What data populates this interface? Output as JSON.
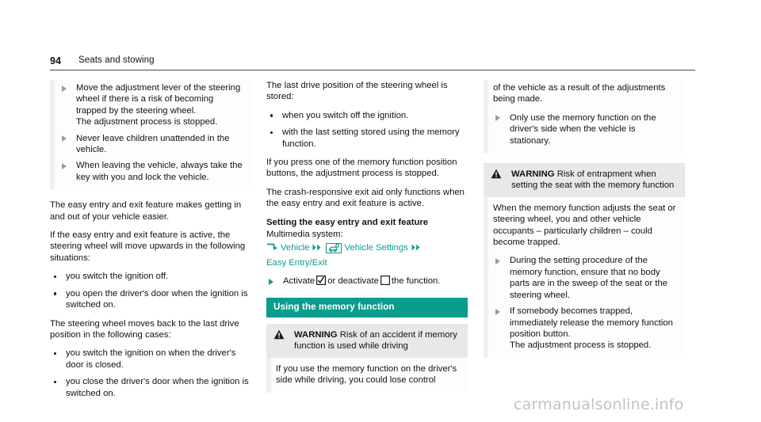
{
  "header": {
    "page_number": "94",
    "section_title": "Seats and stowing"
  },
  "colors": {
    "teal": "#0a9d8d",
    "warning_header_bg": "#e8e8e8",
    "watermark": "#c2c2c2"
  },
  "column1": {
    "continuation_box": {
      "items": [
        "Move the adjustment lever of the steering wheel if there is a risk of becoming trapped by the steering wheel.\nThe adjustment process is stopped.",
        "Never leave children unattended in the vehicle.",
        "When leaving the vehicle, always take the key with you and lock the vehicle."
      ]
    },
    "para_1": "The easy entry and exit feature makes getting in and out of your vehicle easier.",
    "para_2": "If the easy entry and exit feature is active, the steering wheel will move upwards in the following situations:",
    "list_1": [
      "you switch the ignition off.",
      "you open the driver's door when the ignition is switched on."
    ],
    "para_3": "The steering wheel moves back to the last drive position in the following cases:",
    "list_2": [
      "you switch the ignition on when the driver's door is closed.",
      "you close the driver's door when the ignition is switched on."
    ]
  },
  "column2": {
    "para_1": "The last drive position of the steering wheel is stored:",
    "list_1": [
      "when you switch off the ignition.",
      "with the last setting stored using the memory function."
    ],
    "para_2": "If you press one of the memory function position buttons, the adjustment process is stopped.",
    "para_3": "The crash-responsive exit aid only functions when the easy entry and exit feature is active.",
    "subhead": "Setting the easy entry and exit feature",
    "multimedia_label": "Multimedia system:",
    "path": {
      "segment_1": "Vehicle",
      "segment_2": "Vehicle Settings",
      "segment_3": "Easy Entry/Exit",
      "arrow_icon": "enter-arrow-icon",
      "chevron_icon": "double-chevron-icon",
      "vehicle_settings_icon": "vehicle-settings-icon"
    },
    "action": {
      "prefix": "Activate",
      "middle": "or deactivate",
      "suffix": "the function.",
      "checked_icon": "checked-checkbox-icon",
      "unchecked_icon": "unchecked-checkbox-icon"
    },
    "banner": "Using the memory function",
    "warning": {
      "label": "WARNING",
      "title": "Risk of an accident if memory function is used while driving",
      "body": "If you use the memory function on the driver's side while driving, you could lose control",
      "icon": "warning-triangle-icon"
    }
  },
  "column3": {
    "continuation_box": {
      "para": "of the vehicle as a result of the adjustments being made.",
      "items": [
        "Only use the memory function on the driver's side when the vehicle is stationary."
      ]
    },
    "warning": {
      "label": "WARNING",
      "title": "Risk of entrapment when setting the seat with the memory function",
      "icon": "warning-triangle-icon",
      "body": "When the memory function adjusts the seat or steering wheel, you and other vehicle occupants – particularly children – could become trapped.",
      "items": [
        "During the setting procedure of the memory function, ensure that no body parts are in the sweep of the seat or the steering wheel.",
        "If somebody becomes trapped, immediately release the memory function position button.\nThe adjustment process is stopped."
      ]
    }
  },
  "watermark": "carmanualsonline.info"
}
